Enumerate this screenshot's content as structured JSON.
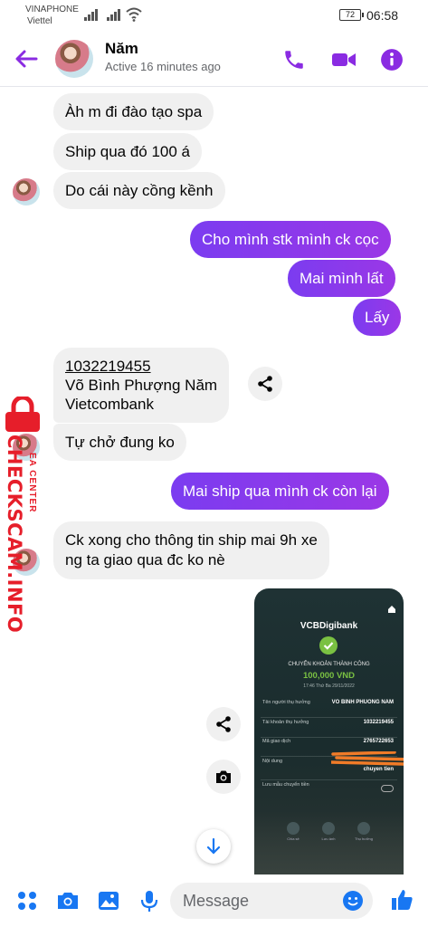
{
  "status_bar": {
    "carrier_primary": "VINAPHONE",
    "carrier_secondary": "Viettel",
    "battery": "72",
    "time": "06:58"
  },
  "header": {
    "contact_name": "Năm",
    "contact_status": "Active 16 minutes ago",
    "accent_color": "#8a2be2",
    "icons": [
      "back-arrow-icon",
      "phone-icon",
      "video-icon",
      "info-icon"
    ]
  },
  "messages": [
    {
      "direction": "in",
      "text": "Àh m đi đào tạo spa"
    },
    {
      "direction": "in",
      "text": "Ship qua đó 100 á"
    },
    {
      "direction": "in",
      "text": "Do cái này cồng kềnh"
    },
    {
      "direction": "out",
      "text": "Cho mình stk mình ck cọc"
    },
    {
      "direction": "out",
      "text": "Mai mình lất"
    },
    {
      "direction": "out",
      "text": "Lấy"
    },
    {
      "direction": "in",
      "lines": [
        "1032219455",
        "Võ Bình Phượng Năm",
        "Vietcombank"
      ]
    },
    {
      "direction": "in",
      "text": "Tự chở đung ko"
    },
    {
      "direction": "out",
      "text": "Mai ship qua mình ck còn lại"
    },
    {
      "direction": "in",
      "lines": [
        "Ck xong cho thông tin ship mai 9h xe",
        "ng ta giao qua đc ko nè"
      ]
    }
  ],
  "receipt": {
    "bank_logo": "VCBDigibank",
    "status_title": "CHUYỂN KHOẢN THÀNH CÔNG",
    "amount": "100,000 VND",
    "datetime": "17:46 Thứ Ba 29/11/2022",
    "rows": [
      {
        "label": "Tên người thụ hưởng",
        "value": "VO BINH PHUONG NAM"
      },
      {
        "label": "Tài khoản thụ hưởng",
        "value": "1032219455"
      },
      {
        "label": "Mã giao dịch",
        "value": "2765722653"
      },
      {
        "label": "Nội dung",
        "value": "chuyen tien"
      },
      {
        "label": "Lưu mẫu chuyển tiền",
        "value": ""
      }
    ],
    "actions": [
      "Chia sẻ",
      "Lưu ảnh",
      "Thụ hưởng"
    ]
  },
  "watermark": {
    "brand": "CHECKSCAM.INFO",
    "sub": "EA CENTER",
    "color": "#e61e2a"
  },
  "composer": {
    "placeholder": "Message",
    "icons": [
      "menu-dots-icon",
      "camera-icon",
      "gallery-icon",
      "microphone-icon",
      "emoji-icon",
      "thumbs-up-icon"
    ]
  }
}
